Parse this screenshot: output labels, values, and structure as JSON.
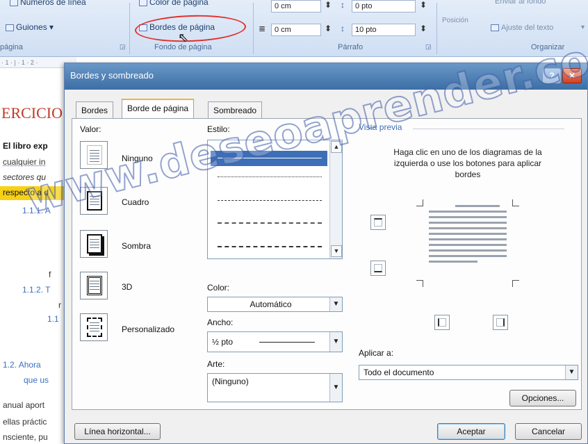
{
  "ribbon": {
    "numeros_linea": "Números de línea",
    "guiones": "Guiones",
    "color_pagina": "Color de página",
    "bordes_pagina": "Bordes de página",
    "fondo_pagina_group": "Fondo de página",
    "pagina_group": "página",
    "indent_left": "0 cm",
    "indent_right": "0 cm",
    "space_before": "0 pto",
    "space_after": "10 pto",
    "parrafo_group": "Párrafo",
    "posicion": "Posición",
    "enviar_fondo": "Enviar al fondo",
    "ajuste_texto": "Ajuste del texto",
    "organizar_group": "Organizar"
  },
  "ruler": {
    "text": "· 1 · | · 1 · 2 ·"
  },
  "document": {
    "heading": "ERCICIO",
    "line1": "El libro exp",
    "line2": "cualquier in",
    "line3": "sectores qu",
    "line4": "respecto a d",
    "item1": "1.1.1. A",
    "item2": "1.1.2. T",
    "item3": "1.1",
    "item4": "1.2.  Ahora",
    "item5": "que us",
    "line5": "anual aport",
    "line6": "ellas práctic",
    "line7": "nsciente, pu",
    "frag_r": "r",
    "frag_f": "f"
  },
  "dialog": {
    "title": "Bordes y sombreado",
    "help": "?",
    "close": "✕",
    "tabs": [
      "Bordes",
      "Borde de página",
      "Sombreado"
    ],
    "valor_label": "Valor:",
    "settings": [
      "Ninguno",
      "Cuadro",
      "Sombra",
      "3D",
      "Personalizado"
    ],
    "estilo_label": "Estilo:",
    "color_label": "Color:",
    "color_value": "Automático",
    "ancho_label": "Ancho:",
    "ancho_value": "½ pto",
    "arte_label": "Arte:",
    "arte_value": "(Ninguno)",
    "preview_label": "Vista previa",
    "preview_instructions": "Haga clic en uno de los diagramas de la izquierda o use los botones para aplicar bordes",
    "aplicar_label": "Aplicar a:",
    "aplicar_value": "Todo el documento",
    "opciones": "Opciones...",
    "linea_horizontal": "Línea horizontal...",
    "aceptar": "Aceptar",
    "cancelar": "Cancelar"
  },
  "watermark": "www.deseoaprender.com",
  "colors": {
    "highlight_oval": "#e0312c",
    "active_tab_accent": "#f2b13a",
    "doc_heading": "#c0392b",
    "doc_highlight": "#f7d117"
  }
}
